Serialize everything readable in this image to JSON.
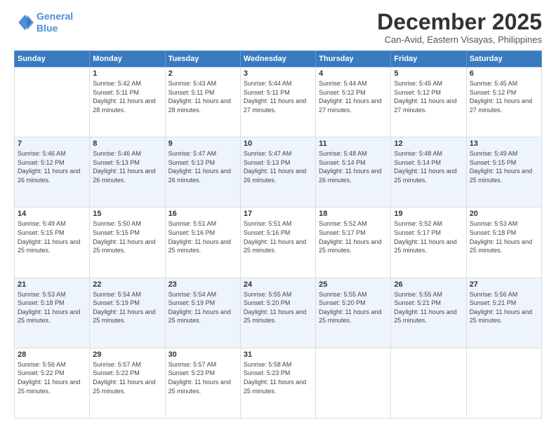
{
  "header": {
    "logo_line1": "General",
    "logo_line2": "Blue",
    "month": "December 2025",
    "location": "Can-Avid, Eastern Visayas, Philippines"
  },
  "weekdays": [
    "Sunday",
    "Monday",
    "Tuesday",
    "Wednesday",
    "Thursday",
    "Friday",
    "Saturday"
  ],
  "weeks": [
    [
      {
        "day": "",
        "sunrise": "",
        "sunset": "",
        "daylight": ""
      },
      {
        "day": "1",
        "sunrise": "Sunrise: 5:42 AM",
        "sunset": "Sunset: 5:11 PM",
        "daylight": "Daylight: 11 hours and 28 minutes."
      },
      {
        "day": "2",
        "sunrise": "Sunrise: 5:43 AM",
        "sunset": "Sunset: 5:11 PM",
        "daylight": "Daylight: 11 hours and 28 minutes."
      },
      {
        "day": "3",
        "sunrise": "Sunrise: 5:44 AM",
        "sunset": "Sunset: 5:11 PM",
        "daylight": "Daylight: 11 hours and 27 minutes."
      },
      {
        "day": "4",
        "sunrise": "Sunrise: 5:44 AM",
        "sunset": "Sunset: 5:12 PM",
        "daylight": "Daylight: 11 hours and 27 minutes."
      },
      {
        "day": "5",
        "sunrise": "Sunrise: 5:45 AM",
        "sunset": "Sunset: 5:12 PM",
        "daylight": "Daylight: 11 hours and 27 minutes."
      },
      {
        "day": "6",
        "sunrise": "Sunrise: 5:45 AM",
        "sunset": "Sunset: 5:12 PM",
        "daylight": "Daylight: 11 hours and 27 minutes."
      }
    ],
    [
      {
        "day": "7",
        "sunrise": "Sunrise: 5:46 AM",
        "sunset": "Sunset: 5:12 PM",
        "daylight": "Daylight: 11 hours and 26 minutes."
      },
      {
        "day": "8",
        "sunrise": "Sunrise: 5:46 AM",
        "sunset": "Sunset: 5:13 PM",
        "daylight": "Daylight: 11 hours and 26 minutes."
      },
      {
        "day": "9",
        "sunrise": "Sunrise: 5:47 AM",
        "sunset": "Sunset: 5:13 PM",
        "daylight": "Daylight: 11 hours and 26 minutes."
      },
      {
        "day": "10",
        "sunrise": "Sunrise: 5:47 AM",
        "sunset": "Sunset: 5:13 PM",
        "daylight": "Daylight: 11 hours and 26 minutes."
      },
      {
        "day": "11",
        "sunrise": "Sunrise: 5:48 AM",
        "sunset": "Sunset: 5:14 PM",
        "daylight": "Daylight: 11 hours and 26 minutes."
      },
      {
        "day": "12",
        "sunrise": "Sunrise: 5:48 AM",
        "sunset": "Sunset: 5:14 PM",
        "daylight": "Daylight: 11 hours and 25 minutes."
      },
      {
        "day": "13",
        "sunrise": "Sunrise: 5:49 AM",
        "sunset": "Sunset: 5:15 PM",
        "daylight": "Daylight: 11 hours and 25 minutes."
      }
    ],
    [
      {
        "day": "14",
        "sunrise": "Sunrise: 5:49 AM",
        "sunset": "Sunset: 5:15 PM",
        "daylight": "Daylight: 11 hours and 25 minutes."
      },
      {
        "day": "15",
        "sunrise": "Sunrise: 5:50 AM",
        "sunset": "Sunset: 5:15 PM",
        "daylight": "Daylight: 11 hours and 25 minutes."
      },
      {
        "day": "16",
        "sunrise": "Sunrise: 5:51 AM",
        "sunset": "Sunset: 5:16 PM",
        "daylight": "Daylight: 11 hours and 25 minutes."
      },
      {
        "day": "17",
        "sunrise": "Sunrise: 5:51 AM",
        "sunset": "Sunset: 5:16 PM",
        "daylight": "Daylight: 11 hours and 25 minutes."
      },
      {
        "day": "18",
        "sunrise": "Sunrise: 5:52 AM",
        "sunset": "Sunset: 5:17 PM",
        "daylight": "Daylight: 11 hours and 25 minutes."
      },
      {
        "day": "19",
        "sunrise": "Sunrise: 5:52 AM",
        "sunset": "Sunset: 5:17 PM",
        "daylight": "Daylight: 11 hours and 25 minutes."
      },
      {
        "day": "20",
        "sunrise": "Sunrise: 5:53 AM",
        "sunset": "Sunset: 5:18 PM",
        "daylight": "Daylight: 11 hours and 25 minutes."
      }
    ],
    [
      {
        "day": "21",
        "sunrise": "Sunrise: 5:53 AM",
        "sunset": "Sunset: 5:18 PM",
        "daylight": "Daylight: 11 hours and 25 minutes."
      },
      {
        "day": "22",
        "sunrise": "Sunrise: 5:54 AM",
        "sunset": "Sunset: 5:19 PM",
        "daylight": "Daylight: 11 hours and 25 minutes."
      },
      {
        "day": "23",
        "sunrise": "Sunrise: 5:54 AM",
        "sunset": "Sunset: 5:19 PM",
        "daylight": "Daylight: 11 hours and 25 minutes."
      },
      {
        "day": "24",
        "sunrise": "Sunrise: 5:55 AM",
        "sunset": "Sunset: 5:20 PM",
        "daylight": "Daylight: 11 hours and 25 minutes."
      },
      {
        "day": "25",
        "sunrise": "Sunrise: 5:55 AM",
        "sunset": "Sunset: 5:20 PM",
        "daylight": "Daylight: 11 hours and 25 minutes."
      },
      {
        "day": "26",
        "sunrise": "Sunrise: 5:55 AM",
        "sunset": "Sunset: 5:21 PM",
        "daylight": "Daylight: 11 hours and 25 minutes."
      },
      {
        "day": "27",
        "sunrise": "Sunrise: 5:56 AM",
        "sunset": "Sunset: 5:21 PM",
        "daylight": "Daylight: 11 hours and 25 minutes."
      }
    ],
    [
      {
        "day": "28",
        "sunrise": "Sunrise: 5:56 AM",
        "sunset": "Sunset: 5:22 PM",
        "daylight": "Daylight: 11 hours and 25 minutes."
      },
      {
        "day": "29",
        "sunrise": "Sunrise: 5:57 AM",
        "sunset": "Sunset: 5:22 PM",
        "daylight": "Daylight: 11 hours and 25 minutes."
      },
      {
        "day": "30",
        "sunrise": "Sunrise: 5:57 AM",
        "sunset": "Sunset: 5:23 PM",
        "daylight": "Daylight: 11 hours and 25 minutes."
      },
      {
        "day": "31",
        "sunrise": "Sunrise: 5:58 AM",
        "sunset": "Sunset: 5:23 PM",
        "daylight": "Daylight: 11 hours and 25 minutes."
      },
      {
        "day": "",
        "sunrise": "",
        "sunset": "",
        "daylight": ""
      },
      {
        "day": "",
        "sunrise": "",
        "sunset": "",
        "daylight": ""
      },
      {
        "day": "",
        "sunrise": "",
        "sunset": "",
        "daylight": ""
      }
    ]
  ]
}
